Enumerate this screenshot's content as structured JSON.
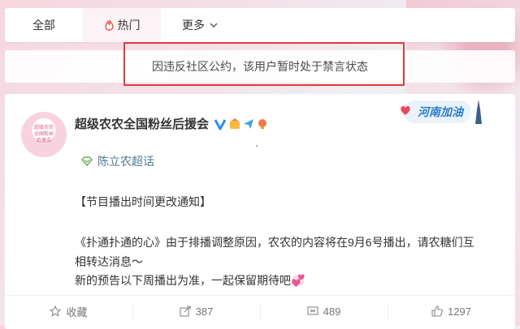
{
  "tabs": {
    "all": "全部",
    "hot": "热门",
    "more": "更多"
  },
  "notice": "因违反社区公约，该用户暂时处于禁言状态",
  "post": {
    "avatar_text": [
      "超级农农",
      "全国粉丝",
      "后援会"
    ],
    "username": "超级农农全国粉丝后援会",
    "henan_badge": "河南加油",
    "topic": "陈立农超话",
    "lines": [
      "【节目播出时间更改通知】",
      "《扑通扑通的心》由于排播调整原因，农农的内容将在9月6号播出，请农糖们互",
      "相转达消息～",
      "新的预告以下周播出为准，一起保留期待吧💞"
    ]
  },
  "actions": {
    "favorite": "收藏",
    "repost": "387",
    "comment": "489",
    "like": "1297"
  },
  "colors": {
    "accent_red": "#e23a3a",
    "flame": "#e8553b",
    "link_blue": "#507a93"
  }
}
